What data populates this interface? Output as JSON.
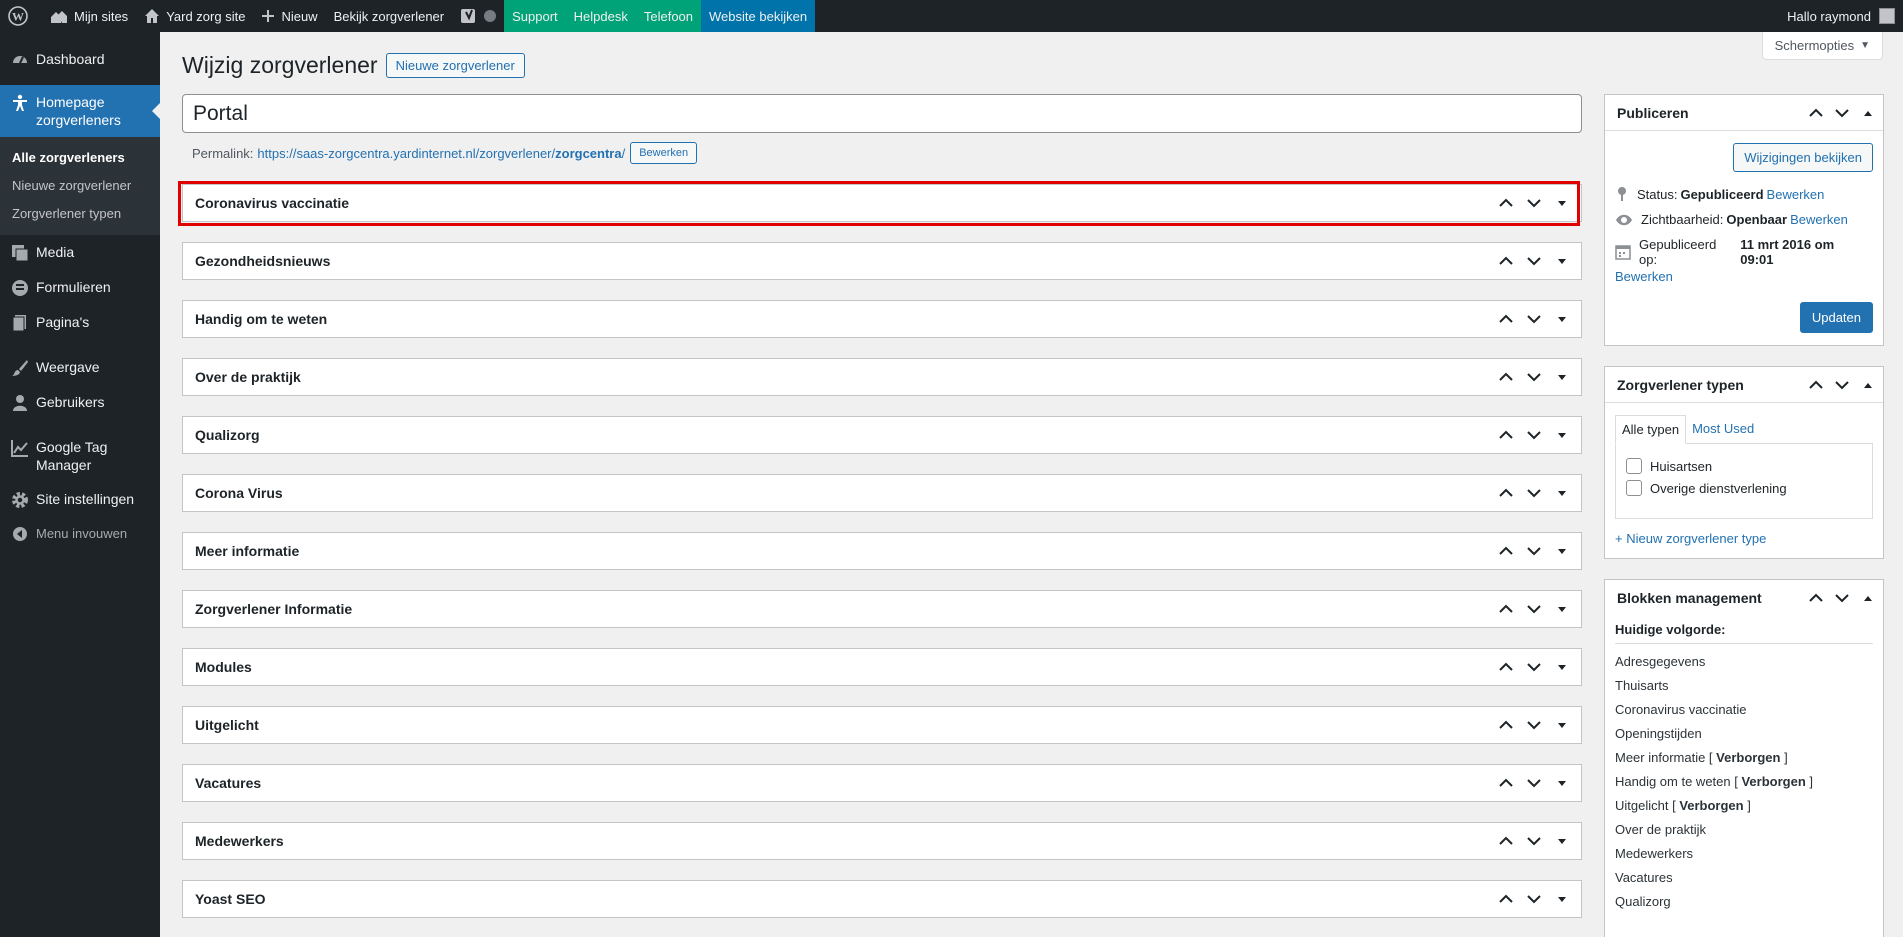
{
  "adminbar": {
    "my_sites": "Mijn sites",
    "site_name": "Yard zorg site",
    "new": "Nieuw",
    "view": "Bekijk zorgverlener",
    "support": "Support",
    "helpdesk": "Helpdesk",
    "telefoon": "Telefoon",
    "website": "Website bekijken",
    "greeting": "Hallo raymond"
  },
  "sidebar": {
    "dashboard": "Dashboard",
    "current": "Homepage zorgverleners",
    "submenu": [
      "Alle zorgverleners",
      "Nieuwe zorgverlener",
      "Zorgverlener typen"
    ],
    "media": "Media",
    "formulieren": "Formulieren",
    "paginas": "Pagina's",
    "weergave": "Weergave",
    "gebruikers": "Gebruikers",
    "gtm": "Google Tag Manager",
    "site_instellingen": "Site instellingen",
    "collapse": "Menu invouwen"
  },
  "screen_options": "Schermopties",
  "page": {
    "title": "Wijzig zorgverlener",
    "new_button": "Nieuwe zorgverlener",
    "post_title": "Portal",
    "permalink_label": "Permalink:",
    "permalink_base": "https://saas-zorgcentra.yardinternet.nl/zorgverlener/",
    "permalink_slug": "zorgcentra",
    "permalink_edit": "Bewerken"
  },
  "postboxes": [
    "Coronavirus vaccinatie",
    "Gezondheidsnieuws",
    "Handig om te weten",
    "Over de praktijk",
    "Qualizorg",
    "Corona Virus",
    "Meer informatie",
    "Zorgverlener Informatie",
    "Modules",
    "Uitgelicht",
    "Vacatures",
    "Medewerkers",
    "Yoast SEO"
  ],
  "publish": {
    "title": "Publiceren",
    "preview": "Wijzigingen bekijken",
    "status_label": "Status:",
    "status_value": "Gepubliceerd",
    "visibility_label": "Zichtbaarheid:",
    "visibility_value": "Openbaar",
    "published_label": "Gepubliceerd op:",
    "published_value": "11 mrt 2016 om 09:01",
    "edit": "Bewerken",
    "update": "Updaten"
  },
  "types": {
    "title": "Zorgverlener typen",
    "tab_all": "Alle typen",
    "tab_most": "Most Used",
    "options": [
      "Huisartsen",
      "Overige dienstverlening"
    ],
    "add_new": "+ Nieuw zorgverlener type"
  },
  "blocks": {
    "title": "Blokken management",
    "order_label": "Huidige volgorde:",
    "items": [
      {
        "name": "Adresgegevens",
        "hidden": ""
      },
      {
        "name": "Thuisarts",
        "hidden": ""
      },
      {
        "name": "Coronavirus vaccinatie",
        "hidden": ""
      },
      {
        "name": "Openingstijden",
        "hidden": ""
      },
      {
        "name": "Meer informatie",
        "hidden": "Verborgen"
      },
      {
        "name": "Handig om te weten",
        "hidden": "Verborgen"
      },
      {
        "name": "Uitgelicht",
        "hidden": "Verborgen"
      },
      {
        "name": "Over de praktijk",
        "hidden": ""
      },
      {
        "name": "Medewerkers",
        "hidden": ""
      },
      {
        "name": "Vacatures",
        "hidden": ""
      },
      {
        "name": "Qualizorg",
        "hidden": ""
      }
    ]
  }
}
